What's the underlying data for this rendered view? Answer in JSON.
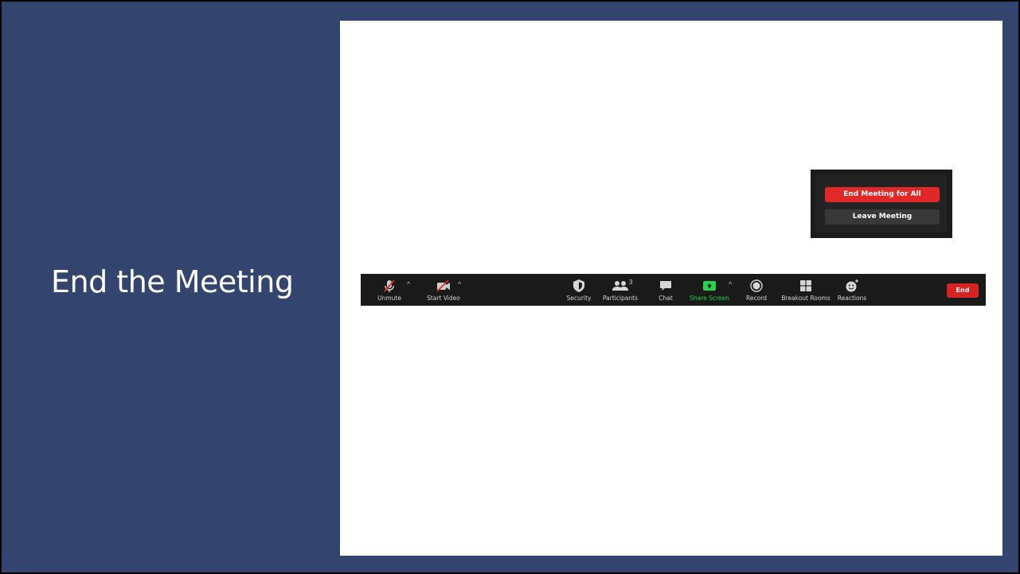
{
  "slide": {
    "title": "End the Meeting",
    "background": "#33446e"
  },
  "popup": {
    "end_all_label": "End Meeting for All",
    "leave_label": "Leave Meeting",
    "end_all_color": "#e02828"
  },
  "toolbar": {
    "items": [
      {
        "label": "Unmute",
        "icon": "mic-muted-icon"
      },
      {
        "label": "Start Video",
        "icon": "video-off-icon"
      },
      {
        "label": "Security",
        "icon": "shield-icon"
      },
      {
        "label": "Participants",
        "icon": "participants-icon",
        "count": "3"
      },
      {
        "label": "Chat",
        "icon": "chat-icon"
      },
      {
        "label": "Share Screen",
        "icon": "share-screen-icon"
      },
      {
        "label": "Record",
        "icon": "record-icon"
      },
      {
        "label": "Breakout Rooms",
        "icon": "breakout-rooms-icon"
      },
      {
        "label": "Reactions",
        "icon": "reactions-icon"
      }
    ],
    "end_label": "End",
    "share_color": "#28d24b"
  }
}
